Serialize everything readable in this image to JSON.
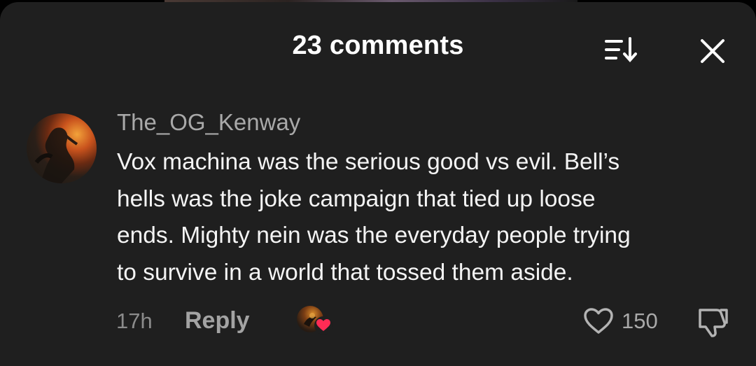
{
  "header": {
    "title": "23 comments",
    "sort_icon": "sort-descending-icon",
    "close_icon": "close-icon"
  },
  "comment": {
    "username": "The_OG_Kenway",
    "avatar_icon": "user-avatar",
    "text_lines": [
      "Vox machina was the serious good vs evil. Bell’s",
      "hells was the joke campaign that tied up loose",
      "ends. Mighty nein was the everyday people trying",
      "to survive in a world that tossed them aside."
    ],
    "timestamp": "17h",
    "reply_label": "Reply",
    "creator_liked_icon": "creator-liked-heart-icon",
    "like_icon": "heart-outline-icon",
    "like_count": "150",
    "dislike_icon": "thumbs-down-icon"
  },
  "colors": {
    "sheet_background": "#1f1f1f",
    "primary_text": "#f4f4f4",
    "secondary_text": "#a9a9a9",
    "heart_accent": "#fe2c55"
  }
}
